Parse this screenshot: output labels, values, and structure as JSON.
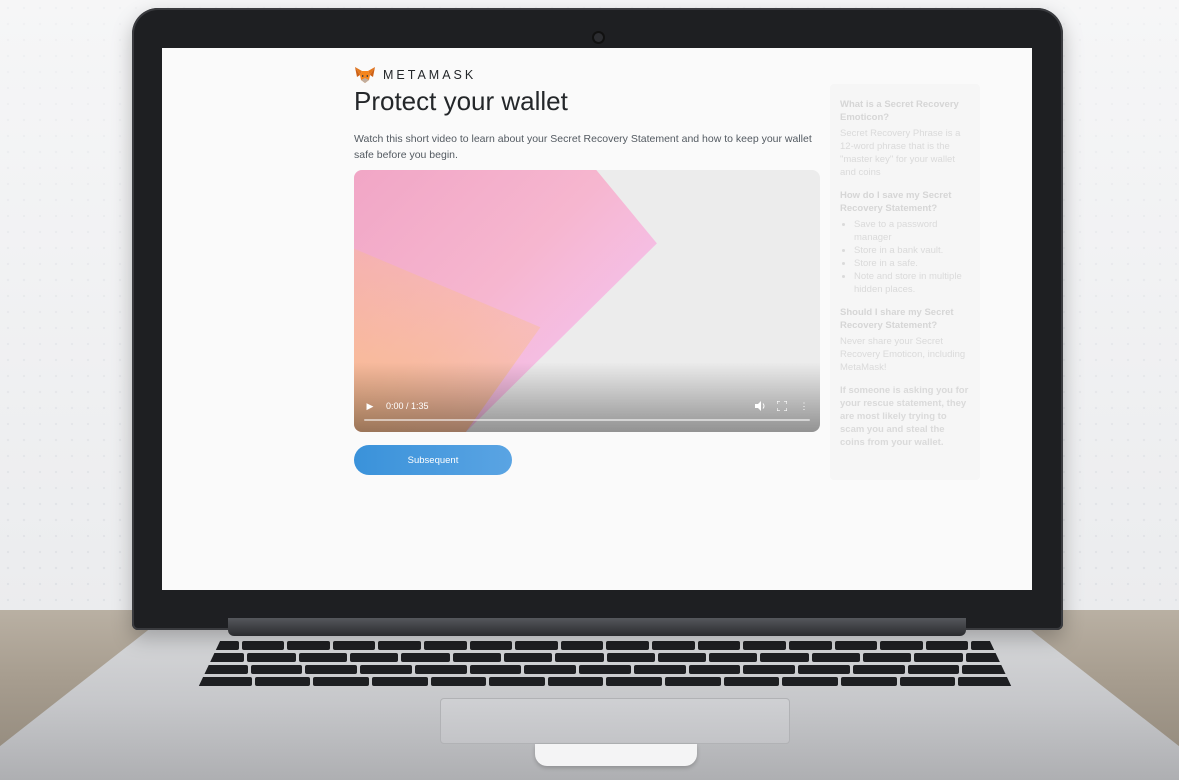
{
  "brand": {
    "name": "METAMASK"
  },
  "page": {
    "title": "Protect your wallet",
    "description": "Watch this short video to learn about your Secret Recovery Statement and how to keep your wallet safe before you begin."
  },
  "video": {
    "time": "0:00 / 1:35",
    "icons": {
      "play": "play-icon",
      "volume": "volume-icon",
      "fullscreen": "fullscreen-icon",
      "more": "more-options-icon"
    }
  },
  "next_button": {
    "label": "Subsequent",
    "color": "#3a92da"
  },
  "faq": {
    "q1": "What is a Secret Recovery Emoticon?",
    "a1": "Secret Recovery Phrase is a 12-word phrase that is the \"master key\" for your wallet and coins",
    "q2": "How do I save my Secret Recovery Statement?",
    "tips": [
      "Save to a password manager",
      "Store in a bank vault.",
      "Store in a safe.",
      "Note and store in multiple hidden places."
    ],
    "q3": "Should I share my Secret Recovery Statement?",
    "a3": "Never share your Secret Recovery Emoticon, including MetaMask!",
    "warning": "If someone is asking you for your rescue statement, they are most likely trying to scam you and steal the coins from your wallet."
  }
}
